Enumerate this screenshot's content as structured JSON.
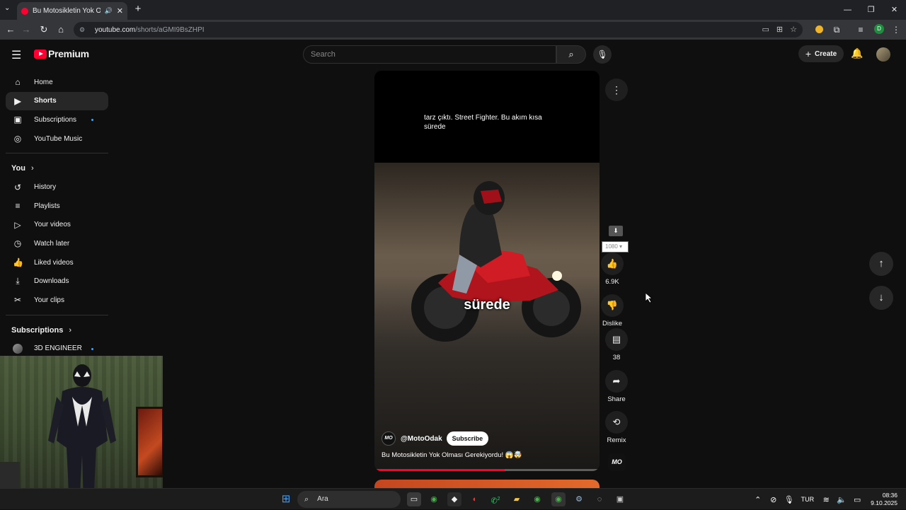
{
  "browser": {
    "tab_title": "Bu Motosikletin Yok Olması...",
    "url_host": "youtube.com",
    "url_path": "/shorts/aGMI9BsZHPI"
  },
  "header": {
    "logo_text": "Premium",
    "search_placeholder": "Search",
    "create_label": "Create"
  },
  "sidebar": {
    "main": [
      {
        "label": "Home",
        "icon": "home-icon"
      },
      {
        "label": "Shorts",
        "icon": "shorts-icon"
      },
      {
        "label": "Subscriptions",
        "icon": "subscriptions-icon"
      },
      {
        "label": "YouTube Music",
        "icon": "music-icon"
      }
    ],
    "you_title": "You",
    "you": [
      {
        "label": "History",
        "icon": "history-icon"
      },
      {
        "label": "Playlists",
        "icon": "playlists-icon"
      },
      {
        "label": "Your videos",
        "icon": "your-videos-icon"
      },
      {
        "label": "Watch later",
        "icon": "clock-icon"
      },
      {
        "label": "Liked videos",
        "icon": "thumbs-up-icon"
      },
      {
        "label": "Downloads",
        "icon": "download-icon"
      },
      {
        "label": "Your clips",
        "icon": "scissors-icon"
      }
    ],
    "subs_title": "Subscriptions",
    "subs": [
      {
        "label": "3D ENGINEER"
      }
    ]
  },
  "short": {
    "caption_top": "tarz çıktı. Street Fighter. Bu akım kısa sürede",
    "caption_mid": "sürede",
    "channel_logo": "MO",
    "channel_name": "@MotoOdak",
    "subscribe_label": "Subscribe",
    "title": "Bu Motosikletin Yok Olması Gerekiyordu! 😱🤯",
    "progress": 0.58
  },
  "actions": {
    "quality": "1080",
    "likes": "6.9K",
    "dislike_label": "Dislike",
    "comments": "38",
    "share_label": "Share",
    "remix_label": "Remix"
  },
  "taskbar": {
    "search_label": "Ara",
    "lang": "TUR",
    "time": "08:36",
    "date": "9.10.2025",
    "whatsapp_badge": "2"
  }
}
